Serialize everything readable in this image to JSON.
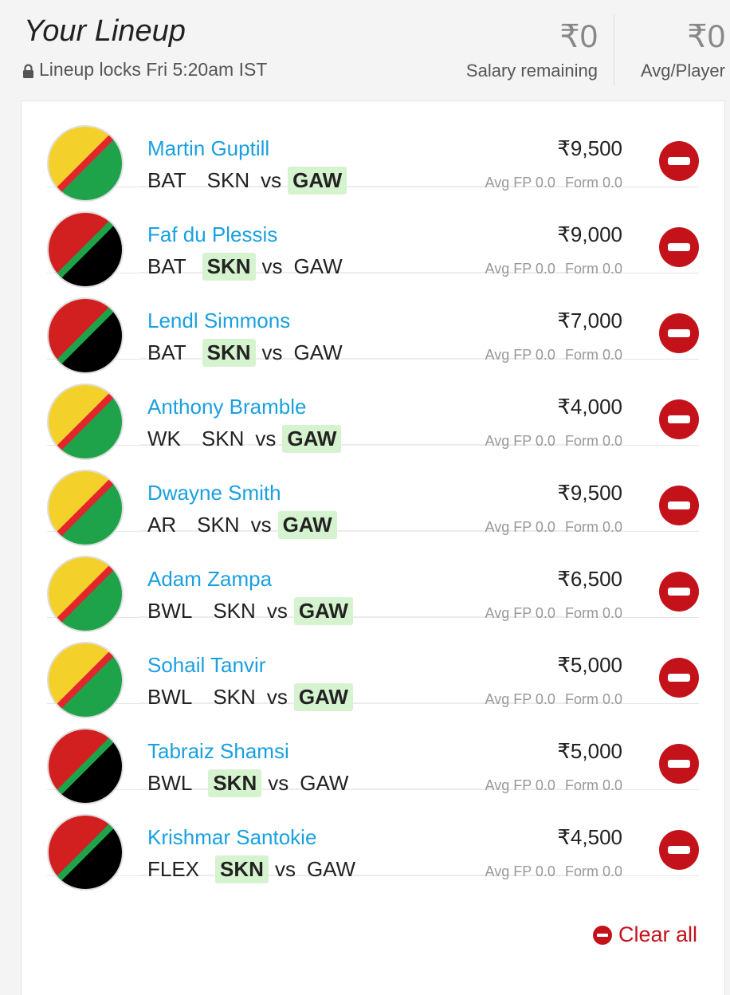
{
  "header": {
    "title": "Your Lineup",
    "lock_text": "Lineup locks Fri 5:20am IST",
    "salary_remaining_value": "₹0",
    "salary_remaining_label": "Salary remaining",
    "avg_player_value": "₹0",
    "avg_player_label": "Avg/Player"
  },
  "colors": {
    "accent_blue": "#1aa0e0",
    "remove_red": "#c4121a",
    "highlight_green": "#d6f3cf",
    "team_gaw": [
      "#f4d12a",
      "#e3262b",
      "#1ea34a"
    ],
    "team_skn": [
      "#d21f1f",
      "#1ea34a",
      "#000000"
    ]
  },
  "players": [
    {
      "name": "Martin Guptill",
      "position": "BAT",
      "team": "GAW",
      "home": "SKN",
      "away": "GAW",
      "salary": "₹9,500",
      "avg_fp_label": "Avg FP",
      "avg_fp": "0.0",
      "form_label": "Form",
      "form": "0.0"
    },
    {
      "name": "Faf du Plessis",
      "position": "BAT",
      "team": "SKN",
      "home": "SKN",
      "away": "GAW",
      "salary": "₹9,000",
      "avg_fp_label": "Avg FP",
      "avg_fp": "0.0",
      "form_label": "Form",
      "form": "0.0"
    },
    {
      "name": "Lendl Simmons",
      "position": "BAT",
      "team": "SKN",
      "home": "SKN",
      "away": "GAW",
      "salary": "₹7,000",
      "avg_fp_label": "Avg FP",
      "avg_fp": "0.0",
      "form_label": "Form",
      "form": "0.0"
    },
    {
      "name": "Anthony Bramble",
      "position": "WK",
      "team": "GAW",
      "home": "SKN",
      "away": "GAW",
      "salary": "₹4,000",
      "avg_fp_label": "Avg FP",
      "avg_fp": "0.0",
      "form_label": "Form",
      "form": "0.0"
    },
    {
      "name": "Dwayne Smith",
      "position": "AR",
      "team": "GAW",
      "home": "SKN",
      "away": "GAW",
      "salary": "₹9,500",
      "avg_fp_label": "Avg FP",
      "avg_fp": "0.0",
      "form_label": "Form",
      "form": "0.0"
    },
    {
      "name": "Adam Zampa",
      "position": "BWL",
      "team": "GAW",
      "home": "SKN",
      "away": "GAW",
      "salary": "₹6,500",
      "avg_fp_label": "Avg FP",
      "avg_fp": "0.0",
      "form_label": "Form",
      "form": "0.0"
    },
    {
      "name": "Sohail Tanvir",
      "position": "BWL",
      "team": "GAW",
      "home": "SKN",
      "away": "GAW",
      "salary": "₹5,000",
      "avg_fp_label": "Avg FP",
      "avg_fp": "0.0",
      "form_label": "Form",
      "form": "0.0"
    },
    {
      "name": "Tabraiz Shamsi",
      "position": "BWL",
      "team": "SKN",
      "home": "SKN",
      "away": "GAW",
      "salary": "₹5,000",
      "avg_fp_label": "Avg FP",
      "avg_fp": "0.0",
      "form_label": "Form",
      "form": "0.0"
    },
    {
      "name": "Krishmar Santokie",
      "position": "FLEX",
      "team": "SKN",
      "home": "SKN",
      "away": "GAW",
      "salary": "₹4,500",
      "avg_fp_label": "Avg FP",
      "avg_fp": "0.0",
      "form_label": "Form",
      "form": "0.0"
    }
  ],
  "matchup_separator": "vs",
  "clear_all_label": "Clear all"
}
